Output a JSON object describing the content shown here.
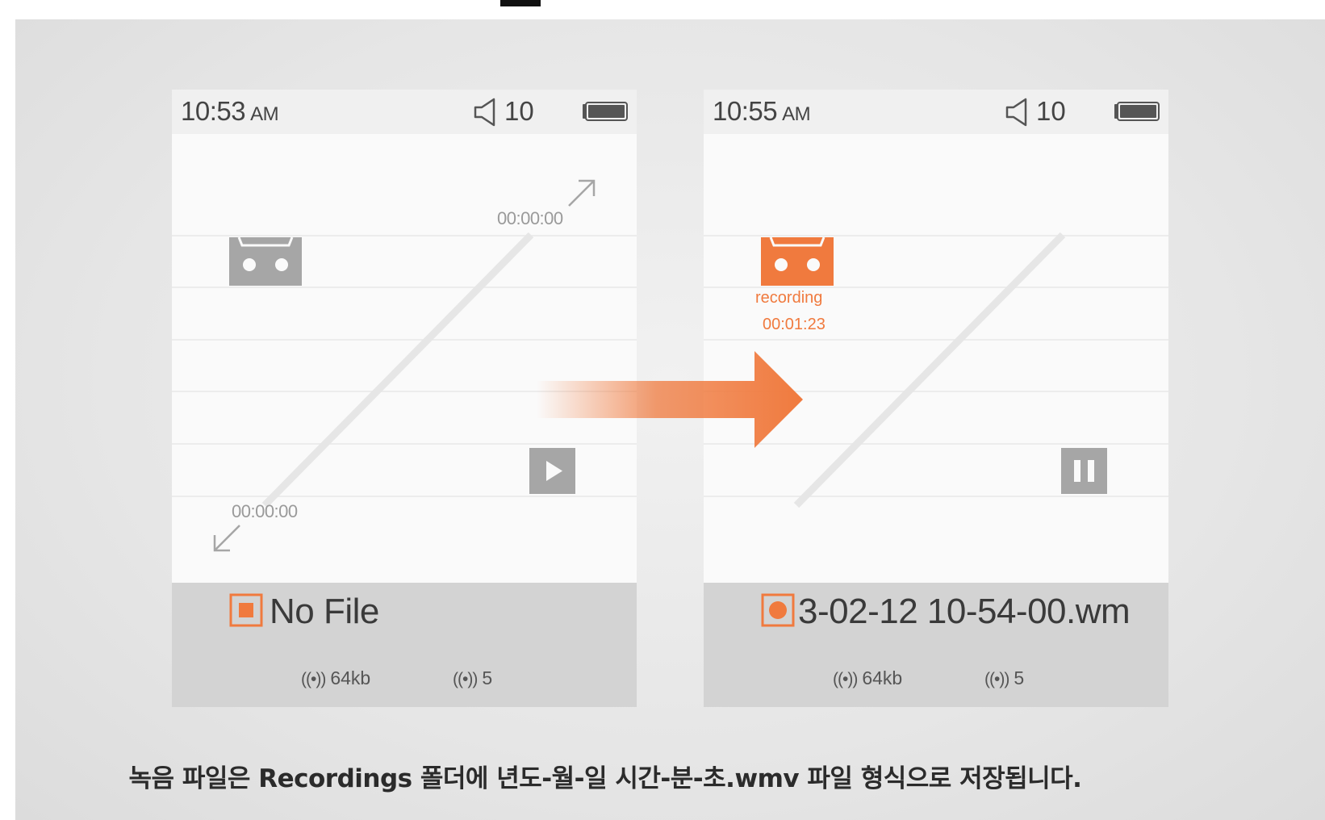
{
  "left_screen": {
    "time": "10:53",
    "ampm": "AM",
    "volume": "10",
    "timecode_top": "00:00:00",
    "timecode_bottom": "00:00:00",
    "file_name": "No File",
    "bitrate": "64kb",
    "level": "5",
    "control_icon": "play-icon"
  },
  "right_screen": {
    "time": "10:55",
    "ampm": "AM",
    "volume": "10",
    "status_label": "recording",
    "elapsed": "00:01:23",
    "file_name": "3-02-12 10-54-00.wm",
    "bitrate": "64kb",
    "level": "5",
    "control_icon": "pause-icon"
  },
  "signal_symbol": "((•))",
  "caption": "녹음 파일은 Recordings 폴더에 년도-월-일 시간-분-초.wmv 파일 형식으로 저장됩니다.",
  "colors": {
    "accent": "#f07a3e",
    "gray_icon": "#a6a6a6",
    "bottom_bar": "#d3d3d3"
  }
}
